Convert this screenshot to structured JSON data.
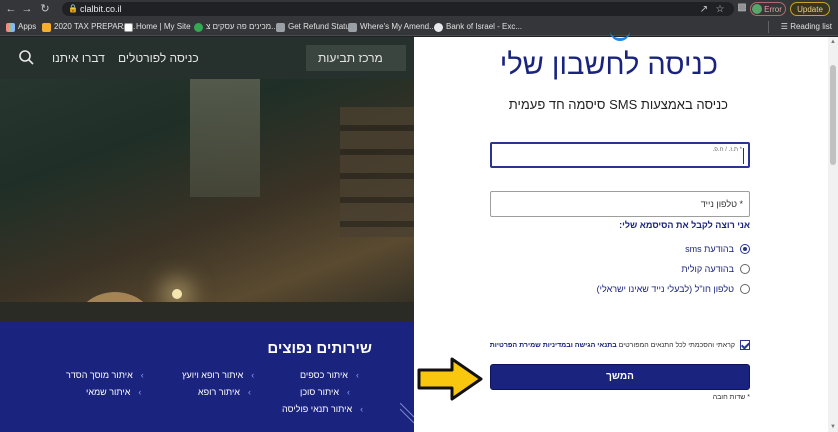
{
  "browser": {
    "url": "clalbit.co.il",
    "error_label": "Error",
    "update_label": "Update"
  },
  "bookmarks": {
    "items": [
      {
        "label": "Apps",
        "color": "#f28b82"
      },
      {
        "label": "2020 TAX PREPARA...",
        "color": "#f6ae2d"
      },
      {
        "label": "Home | My Site",
        "color": "#ffffff"
      },
      {
        "label": "מכינים פה עסקים צ...",
        "color": "#34a853"
      },
      {
        "label": "Get Refund Status",
        "color": "#9aa0a6"
      },
      {
        "label": "Where's My Amend...",
        "color": "#9aa0a6"
      },
      {
        "label": "Bank of Israel - Exc...",
        "color": "#e8eaed"
      }
    ],
    "reading_list": "Reading list"
  },
  "site_header": {
    "talk_to_us": "דברו איתנו",
    "portals": "כניסה לפורטלים",
    "claims_center": "מרכז תביעות"
  },
  "services": {
    "title": "שירותים נפוצים",
    "items": [
      "איתור כספים",
      "איתור רופא ויועץ",
      "איתור מוסך הסדר",
      "איתור סוכן",
      "איתור רופא",
      "איתור שמאי",
      "איתור תנאי פוליסה"
    ]
  },
  "login": {
    "title": "כניסה לחשבון שלי",
    "subtitle": "כניסה באמצעות SMS סיסמה חד פעמית",
    "id_label": "* ת.ז. / ח.פ.",
    "phone_placeholder": "* טלפון נייד",
    "question": "אני רוצה לקבל את הסיסמא שלי:",
    "options": [
      {
        "label": "בהודעת sms",
        "checked": true
      },
      {
        "label": "בהודעה קולית",
        "checked": false
      },
      {
        "label": "טלפון חו\"ל (לבעלי נייד שאינו ישראלי)",
        "checked": false
      }
    ],
    "consent_prefix": "קראתי והסכמתי לכל התנאים המפורטים ",
    "consent_link": "בתנאי הגישה ובמדיניות שמירת הפרטיות",
    "continue_label": "המשך",
    "required_note": "* שדות חובה"
  },
  "colors": {
    "brand_navy": "#1a237e",
    "annotation_arrow": "#f9c80e"
  }
}
